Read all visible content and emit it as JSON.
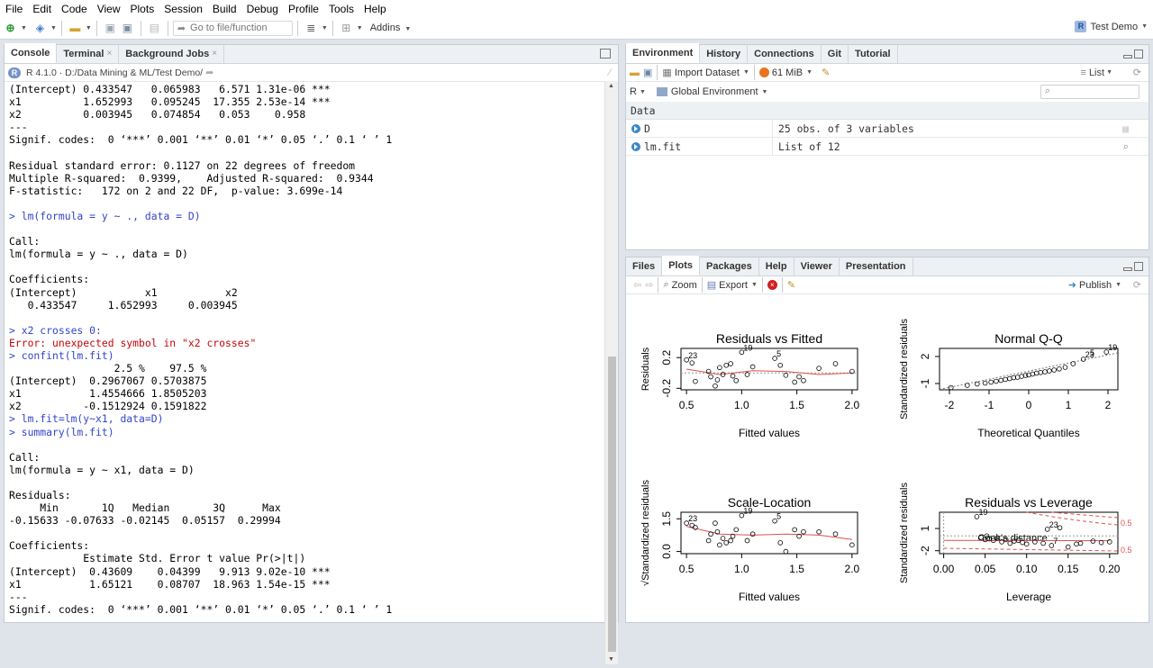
{
  "menu": [
    "File",
    "Edit",
    "Code",
    "View",
    "Plots",
    "Session",
    "Build",
    "Debug",
    "Profile",
    "Tools",
    "Help"
  ],
  "toolbar": {
    "goto_placeholder": "Go to file/function",
    "addins_label": "Addins",
    "project_label": "Test Demo"
  },
  "console": {
    "tabs": [
      "Console",
      "Terminal",
      "Background Jobs"
    ],
    "path": "R 4.1.0 · D:/Data Mining & ML/Test Demo/",
    "lines": [
      {
        "t": "(Intercept) 0.433547   0.065983   6.571 1.31e-06 ***",
        "c": ""
      },
      {
        "t": "x1          1.652993   0.095245  17.355 2.53e-14 ***",
        "c": ""
      },
      {
        "t": "x2          0.003945   0.074854   0.053    0.958",
        "c": ""
      },
      {
        "t": "---",
        "c": ""
      },
      {
        "t": "Signif. codes:  0 ‘***’ 0.001 ‘**’ 0.01 ‘*’ 0.05 ‘.’ 0.1 ‘ ’ 1",
        "c": ""
      },
      {
        "t": "",
        "c": ""
      },
      {
        "t": "Residual standard error: 0.1127 on 22 degrees of freedom",
        "c": ""
      },
      {
        "t": "Multiple R-squared:  0.9399,    Adjusted R-squared:  0.9344",
        "c": ""
      },
      {
        "t": "F-statistic:   172 on 2 and 22 DF,  p-value: 3.699e-14",
        "c": ""
      },
      {
        "t": "",
        "c": ""
      },
      {
        "t": "> lm(formula = y ~ ., data = D)",
        "c": "cmd"
      },
      {
        "t": "",
        "c": ""
      },
      {
        "t": "Call:",
        "c": ""
      },
      {
        "t": "lm(formula = y ~ ., data = D)",
        "c": ""
      },
      {
        "t": "",
        "c": ""
      },
      {
        "t": "Coefficients:",
        "c": ""
      },
      {
        "t": "(Intercept)           x1           x2",
        "c": ""
      },
      {
        "t": "   0.433547     1.652993     0.003945",
        "c": ""
      },
      {
        "t": "",
        "c": ""
      },
      {
        "t": "> x2 crosses 0:",
        "c": "cmd"
      },
      {
        "t": "Error: unexpected symbol in \"x2 crosses\"",
        "c": "err"
      },
      {
        "t": "> confint(lm.fit)",
        "c": "cmd"
      },
      {
        "t": "                 2.5 %    97.5 %",
        "c": ""
      },
      {
        "t": "(Intercept)  0.2967067 0.5703875",
        "c": ""
      },
      {
        "t": "x1           1.4554666 1.8505203",
        "c": ""
      },
      {
        "t": "x2          -0.1512924 0.1591822",
        "c": ""
      },
      {
        "t": "> lm.fit=lm(y~x1, data=D)",
        "c": "cmd"
      },
      {
        "t": "> summary(lm.fit)",
        "c": "cmd"
      },
      {
        "t": "",
        "c": ""
      },
      {
        "t": "Call:",
        "c": ""
      },
      {
        "t": "lm(formula = y ~ x1, data = D)",
        "c": ""
      },
      {
        "t": "",
        "c": ""
      },
      {
        "t": "Residuals:",
        "c": ""
      },
      {
        "t": "     Min       1Q   Median       3Q      Max",
        "c": ""
      },
      {
        "t": "-0.15633 -0.07633 -0.02145  0.05157  0.29994",
        "c": ""
      },
      {
        "t": "",
        "c": ""
      },
      {
        "t": "Coefficients:",
        "c": ""
      },
      {
        "t": "            Estimate Std. Error t value Pr(>|t|)",
        "c": ""
      },
      {
        "t": "(Intercept)  0.43609    0.04399   9.913 9.02e-10 ***",
        "c": ""
      },
      {
        "t": "x1           1.65121    0.08707  18.963 1.54e-15 ***",
        "c": ""
      },
      {
        "t": "---",
        "c": ""
      },
      {
        "t": "Signif. codes:  0 ‘***’ 0.001 ‘**’ 0.01 ‘*’ 0.05 ‘.’ 0.1 ‘ ’ 1",
        "c": ""
      }
    ]
  },
  "env": {
    "tabs": [
      "Environment",
      "History",
      "Connections",
      "Git",
      "Tutorial"
    ],
    "import_label": "Import Dataset",
    "memory_label": "61 MiB",
    "list_label": "List",
    "r_label": "R",
    "scope_label": "Global Environment",
    "section": "Data",
    "rows": [
      {
        "name": "D",
        "value": "25 obs. of 3 variables"
      },
      {
        "name": "lm.fit",
        "value": "List of  12"
      }
    ]
  },
  "files": {
    "tabs": [
      "Files",
      "Plots",
      "Packages",
      "Help",
      "Viewer",
      "Presentation"
    ],
    "zoom_label": "Zoom",
    "export_label": "Export",
    "publish_label": "Publish"
  },
  "chart_data": [
    {
      "type": "scatter",
      "title": "Residuals vs Fitted",
      "xlabel": "Fitted values",
      "ylabel": "Residuals",
      "xlim": [
        0.45,
        2.05
      ],
      "ylim": [
        -0.22,
        0.32
      ],
      "xticks": [
        "0.5",
        "1.0",
        "1.5",
        "2.0"
      ],
      "yticks": [
        "-0.2",
        "0.2"
      ],
      "yticks_values": [
        -0.2,
        0.2
      ],
      "xticks_values": [
        0.5,
        1.0,
        1.5,
        2.0
      ],
      "points": [
        [
          0.5,
          0.17
        ],
        [
          0.55,
          0.13
        ],
        [
          0.58,
          -0.11
        ],
        [
          0.7,
          0.02
        ],
        [
          0.72,
          -0.05
        ],
        [
          0.76,
          -0.17
        ],
        [
          0.78,
          -0.09
        ],
        [
          0.8,
          0.07
        ],
        [
          0.83,
          -0.02
        ],
        [
          0.86,
          0.1
        ],
        [
          0.9,
          0.12
        ],
        [
          0.92,
          -0.04
        ],
        [
          0.95,
          -0.1
        ],
        [
          1.0,
          0.27
        ],
        [
          1.05,
          -0.02
        ],
        [
          1.1,
          0.08
        ],
        [
          1.3,
          0.19
        ],
        [
          1.35,
          0.1
        ],
        [
          1.4,
          -0.03
        ],
        [
          1.48,
          -0.12
        ],
        [
          1.52,
          -0.05
        ],
        [
          1.56,
          -0.1
        ],
        [
          1.7,
          0.06
        ],
        [
          1.85,
          0.12
        ],
        [
          2.0,
          0.02
        ]
      ],
      "labels": [
        {
          "text": "23",
          "x": 0.5,
          "y": 0.17
        },
        {
          "text": "19",
          "x": 1.0,
          "y": 0.27
        },
        {
          "text": "5",
          "x": 1.3,
          "y": 0.19
        }
      ],
      "smooth": [
        [
          0.5,
          0.05
        ],
        [
          0.8,
          -0.02
        ],
        [
          1.1,
          0.03
        ],
        [
          1.4,
          0.02
        ],
        [
          1.7,
          -0.02
        ],
        [
          2.0,
          0.0
        ]
      ]
    },
    {
      "type": "scatter",
      "title": "Normal Q-Q",
      "xlabel": "Theoretical Quantiles",
      "ylabel": "Standardized residuals",
      "xlim": [
        -2.25,
        2.25
      ],
      "ylim": [
        -1.7,
        2.9
      ],
      "xticks": [
        "-2",
        "-1",
        "0",
        "1",
        "2"
      ],
      "yticks": [
        "-1",
        "2"
      ],
      "yticks_values": [
        -1,
        2
      ],
      "xticks_values": [
        -2,
        -1,
        0,
        1,
        2
      ],
      "points": [
        [
          -1.96,
          -1.45
        ],
        [
          -1.55,
          -1.2
        ],
        [
          -1.3,
          -1.05
        ],
        [
          -1.1,
          -0.95
        ],
        [
          -0.95,
          -0.85
        ],
        [
          -0.82,
          -0.75
        ],
        [
          -0.7,
          -0.65
        ],
        [
          -0.59,
          -0.55
        ],
        [
          -0.48,
          -0.45
        ],
        [
          -0.38,
          -0.35
        ],
        [
          -0.28,
          -0.3
        ],
        [
          -0.18,
          -0.2
        ],
        [
          -0.08,
          -0.1
        ],
        [
          0.0,
          -0.05
        ],
        [
          0.1,
          0.05
        ],
        [
          0.2,
          0.15
        ],
        [
          0.3,
          0.22
        ],
        [
          0.41,
          0.3
        ],
        [
          0.52,
          0.4
        ],
        [
          0.64,
          0.5
        ],
        [
          0.77,
          0.62
        ],
        [
          0.92,
          0.8
        ],
        [
          1.12,
          1.2
        ],
        [
          1.38,
          1.7
        ],
        [
          1.96,
          2.5
        ]
      ],
      "labels": [
        {
          "text": "19",
          "x": 1.96,
          "y": 2.5
        },
        {
          "text": "23",
          "x": 1.38,
          "y": 1.7
        },
        {
          "text": "5",
          "x": 1.5,
          "y": 1.9
        }
      ],
      "refline": [
        [
          -2.25,
          -1.65
        ],
        [
          2.25,
          2.4
        ]
      ]
    },
    {
      "type": "scatter",
      "title": "Scale-Location",
      "xlabel": "Fitted values",
      "ylabel": "√Standardized residuals",
      "xlim": [
        0.45,
        2.05
      ],
      "ylim": [
        -0.1,
        1.8
      ],
      "xticks": [
        "0.5",
        "1.0",
        "1.5",
        "2.0"
      ],
      "yticks": [
        "0.0",
        "1.5"
      ],
      "yticks_values": [
        0.0,
        1.5
      ],
      "xticks_values": [
        0.5,
        1.0,
        1.5,
        2.0
      ],
      "points": [
        [
          0.5,
          1.3
        ],
        [
          0.55,
          1.2
        ],
        [
          0.58,
          1.1
        ],
        [
          0.7,
          0.5
        ],
        [
          0.72,
          0.8
        ],
        [
          0.76,
          1.3
        ],
        [
          0.78,
          0.9
        ],
        [
          0.8,
          0.3
        ],
        [
          0.83,
          0.6
        ],
        [
          0.86,
          0.4
        ],
        [
          0.9,
          0.5
        ],
        [
          0.92,
          0.7
        ],
        [
          0.95,
          1.0
        ],
        [
          1.0,
          1.65
        ],
        [
          1.05,
          0.5
        ],
        [
          1.1,
          0.8
        ],
        [
          1.3,
          1.4
        ],
        [
          1.35,
          0.4
        ],
        [
          1.4,
          0.0
        ],
        [
          1.48,
          1.0
        ],
        [
          1.52,
          0.7
        ],
        [
          1.56,
          0.9
        ],
        [
          1.7,
          0.9
        ],
        [
          1.85,
          0.8
        ],
        [
          2.0,
          0.3
        ]
      ],
      "labels": [
        {
          "text": "23",
          "x": 0.5,
          "y": 1.3
        },
        {
          "text": "19",
          "x": 1.0,
          "y": 1.65
        },
        {
          "text": "5",
          "x": 1.3,
          "y": 1.4
        }
      ],
      "smooth": [
        [
          0.5,
          1.15
        ],
        [
          0.8,
          0.8
        ],
        [
          1.1,
          0.75
        ],
        [
          1.4,
          0.8
        ],
        [
          1.7,
          0.75
        ],
        [
          2.0,
          0.55
        ]
      ]
    },
    {
      "type": "scatter",
      "title": "Residuals vs Leverage",
      "xlabel": "Leverage",
      "ylabel": "Standardized residuals",
      "xlim": [
        -0.005,
        0.21
      ],
      "ylim": [
        -2.4,
        3.2
      ],
      "xticks": [
        "0.00",
        "0.05",
        "0.10",
        "0.15",
        "0.20"
      ],
      "yticks": [
        "-2",
        "1"
      ],
      "yticks_values": [
        -2,
        1
      ],
      "xticks_values": [
        0.0,
        0.05,
        0.1,
        0.15,
        0.2
      ],
      "points": [
        [
          0.04,
          2.6
        ],
        [
          0.045,
          -0.2
        ],
        [
          0.05,
          -0.5
        ],
        [
          0.052,
          0.0
        ],
        [
          0.055,
          -0.4
        ],
        [
          0.06,
          -0.6
        ],
        [
          0.065,
          -0.3
        ],
        [
          0.07,
          -0.8
        ],
        [
          0.075,
          -0.5
        ],
        [
          0.08,
          -1.0
        ],
        [
          0.085,
          -0.7
        ],
        [
          0.09,
          -0.6
        ],
        [
          0.095,
          -0.9
        ],
        [
          0.1,
          -1.1
        ],
        [
          0.11,
          -0.8
        ],
        [
          0.12,
          -1.0
        ],
        [
          0.125,
          0.9
        ],
        [
          0.13,
          -1.3
        ],
        [
          0.14,
          1.1
        ],
        [
          0.15,
          -1.5
        ],
        [
          0.16,
          -1.1
        ],
        [
          0.165,
          -1.0
        ],
        [
          0.18,
          -0.7
        ],
        [
          0.19,
          -0.9
        ],
        [
          0.2,
          -0.8
        ]
      ],
      "labels": [
        {
          "text": "19",
          "x": 0.04,
          "y": 2.6
        },
        {
          "text": "23",
          "x": 0.125,
          "y": 0.9
        },
        {
          "text": "7",
          "x": 0.13,
          "y": -1.3
        }
      ],
      "annotation": "Cook's distance",
      "contour_labels": [
        "0.5",
        "0.5"
      ]
    }
  ]
}
